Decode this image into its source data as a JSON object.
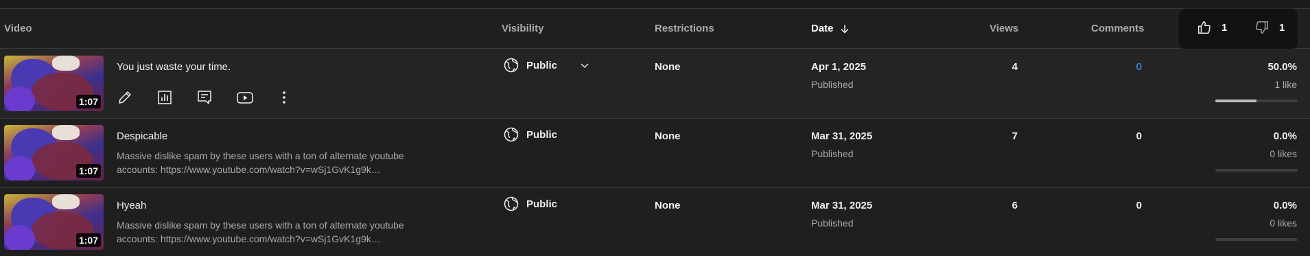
{
  "header": {
    "video": "Video",
    "visibility": "Visibility",
    "restrictions": "Restrictions",
    "date": "Date",
    "views": "Views",
    "comments": "Comments"
  },
  "hover_card": {
    "likes": "1",
    "dislikes": "1"
  },
  "rows": [
    {
      "title": "You just waste your time.",
      "duration": "1:07",
      "description_line1": "",
      "description_line2": "",
      "visibility": "Public",
      "restrictions": "None",
      "date": "Apr 1, 2025",
      "date_status": "Published",
      "views": "4",
      "comments": "0",
      "like_percent": "50.0%",
      "likes_label": "1 like",
      "like_ratio": 0.5
    },
    {
      "title": "Despicable",
      "duration": "1:07",
      "description_line1": "Massive dislike spam by these users with a ton of alternate youtube",
      "description_line2": "accounts: https://www.youtube.com/watch?v=wSj1GvK1g9k…",
      "visibility": "Public",
      "restrictions": "None",
      "date": "Mar 31, 2025",
      "date_status": "Published",
      "views": "7",
      "comments": "0",
      "like_percent": "0.0%",
      "likes_label": "0 likes",
      "like_ratio": 0
    },
    {
      "title": "Hyeah",
      "duration": "1:07",
      "description_line1": "Massive dislike spam by these users with a ton of alternate youtube",
      "description_line2": "accounts: https://www.youtube.com/watch?v=wSj1GvK1g9k…",
      "visibility": "Public",
      "restrictions": "None",
      "date": "Mar 31, 2025",
      "date_status": "Published",
      "views": "6",
      "comments": "0",
      "like_percent": "0.0%",
      "likes_label": "0 likes",
      "like_ratio": 0
    }
  ],
  "colors": {
    "background": "#1f1f1f",
    "hover_row": "#242424",
    "link": "#3ea6ff",
    "muted": "#aaaaaa"
  },
  "icons": {
    "sort": "arrow-down-icon",
    "like": "thumb-up-icon",
    "dislike": "thumb-down-icon",
    "visibility": "globe-icon",
    "edit": "pencil-icon",
    "analytics": "bar-chart-icon",
    "comments": "comment-icon",
    "youtube": "youtube-icon",
    "options": "more-vert-icon"
  }
}
